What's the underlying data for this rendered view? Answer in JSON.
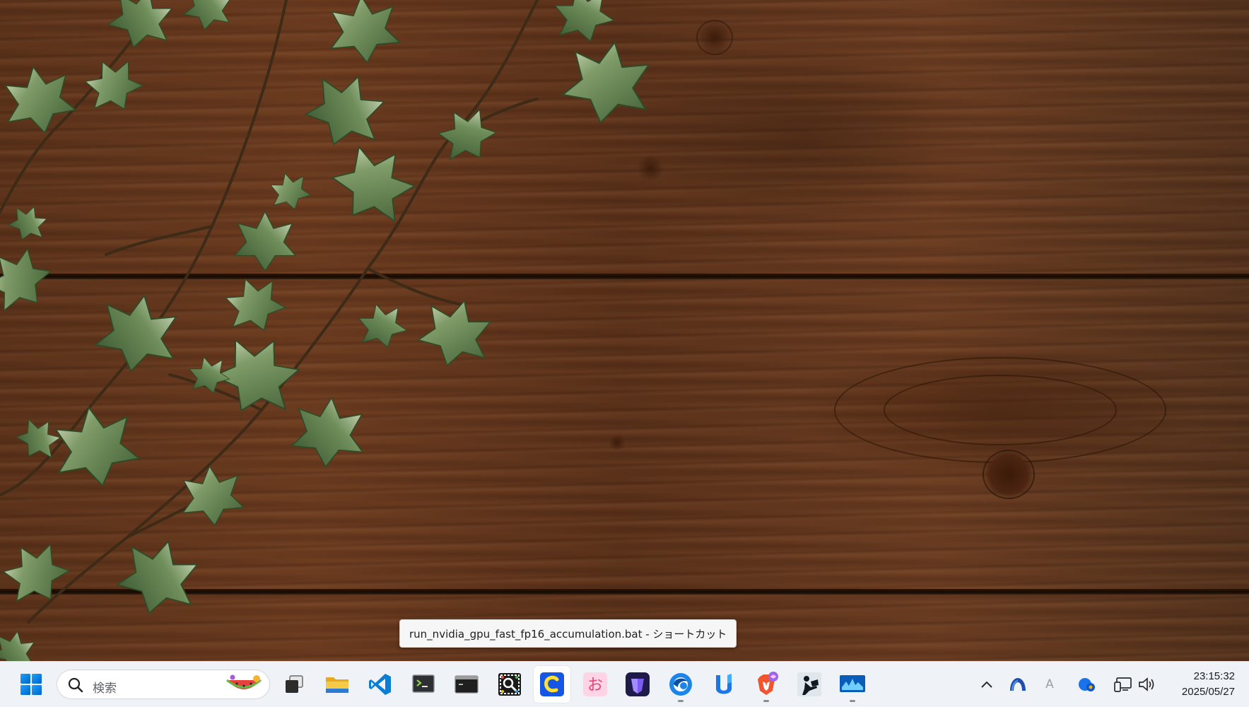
{
  "tooltip": {
    "text": "run_nvidia_gpu_fast_fp16_accumulation.bat - ショートカット"
  },
  "taskbar": {
    "start_icon": "windows-start-icon",
    "search": {
      "placeholder": "検索",
      "icon": "search-icon"
    },
    "apps": [
      {
        "name": "task-view",
        "icon": "task-view-icon",
        "active": false,
        "running": false
      },
      {
        "name": "file-explorer",
        "icon": "folder-icon",
        "active": false,
        "running": false
      },
      {
        "name": "visual-studio-code",
        "icon": "vscode-icon",
        "active": false,
        "running": false
      },
      {
        "name": "terminal-gpu",
        "icon": "terminal-icon",
        "active": false,
        "running": false
      },
      {
        "name": "command-prompt",
        "icon": "console-icon",
        "active": false,
        "running": false
      },
      {
        "name": "screen-capture",
        "icon": "capture-icon",
        "active": false,
        "running": false
      },
      {
        "name": "c-app",
        "icon": "c-logo-icon",
        "active": true,
        "running": false
      },
      {
        "name": "o-app",
        "icon": "hiragana-o-icon",
        "active": false,
        "running": false
      },
      {
        "name": "shield-app",
        "icon": "purple-gem-icon",
        "active": false,
        "running": false
      },
      {
        "name": "edge-browser",
        "icon": "browser-icon",
        "active": false,
        "running": true
      },
      {
        "name": "u-app",
        "icon": "u-logo-icon",
        "active": false,
        "running": false
      },
      {
        "name": "brave-browser",
        "icon": "brave-lion-icon",
        "active": false,
        "running": true
      },
      {
        "name": "reader-app",
        "icon": "reading-person-icon",
        "active": false,
        "running": false
      },
      {
        "name": "monitor-app",
        "icon": "waveform-icon",
        "active": false,
        "running": true
      }
    ],
    "tray": {
      "overflow_icon": "chevron-up-icon",
      "icons": [
        "arch-icon",
        "ime-a-icon",
        "cloud-sync-icon",
        "network-icon",
        "volume-icon"
      ],
      "ime_label": "A"
    },
    "clock": {
      "time": "23:15:32",
      "date": "2025/05/27"
    }
  },
  "colors": {
    "taskbar_bg": "#eff3f8",
    "windows_blue": "#0078d4",
    "wood": "#5b3119"
  }
}
